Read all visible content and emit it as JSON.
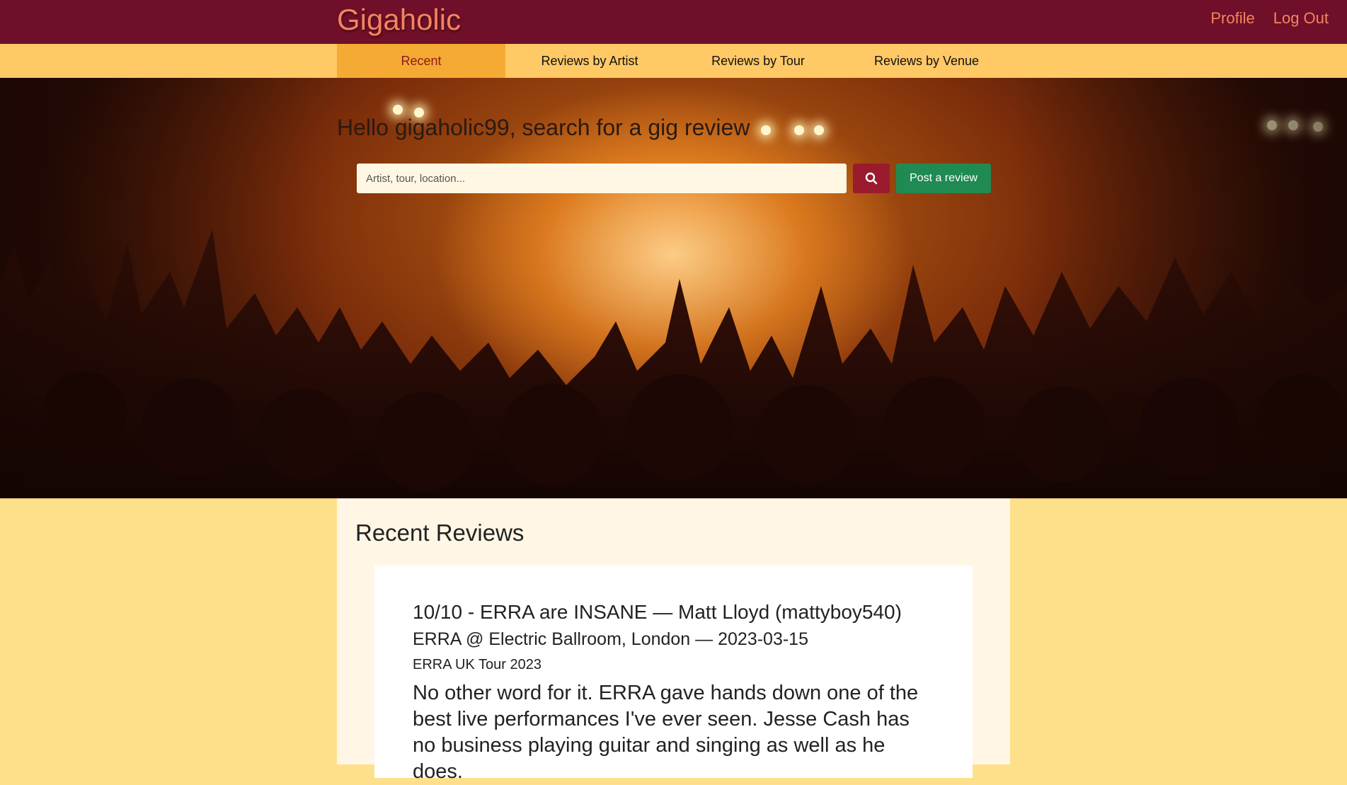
{
  "header": {
    "brand": "Gigaholic",
    "links": [
      "Profile",
      "Log Out"
    ]
  },
  "nav": {
    "tabs": [
      "Recent",
      "Reviews by Artist",
      "Reviews by Tour",
      "Reviews by Venue"
    ],
    "active": "Recent"
  },
  "hero": {
    "greeting": "Hello gigaholic99, search for a gig review",
    "search_placeholder": "Artist, tour, location...",
    "search_icon": "search-icon",
    "post_label": "Post a review"
  },
  "main": {
    "section_title": "Recent Reviews",
    "reviews": [
      {
        "title": "10/10 - ERRA are INSANE — Matt Lloyd (mattyboy540)",
        "meta": "ERRA @ Electric Ballroom, London — 2023-03-15",
        "tour": "ERRA UK Tour 2023",
        "body": "No other word for it. ERRA gave hands down one of the best live performances I've ever seen. Jesse Cash has no business playing guitar and singing as well as he does."
      }
    ]
  },
  "colors": {
    "header_bg": "#6f0f29",
    "brand": "#f4845f",
    "nav_bg": "#ffc966",
    "tab_active_bg": "#f5aa34",
    "page_bg": "#ffe08a",
    "search_button": "#9c1a2e",
    "post_button": "#1f8a52"
  }
}
